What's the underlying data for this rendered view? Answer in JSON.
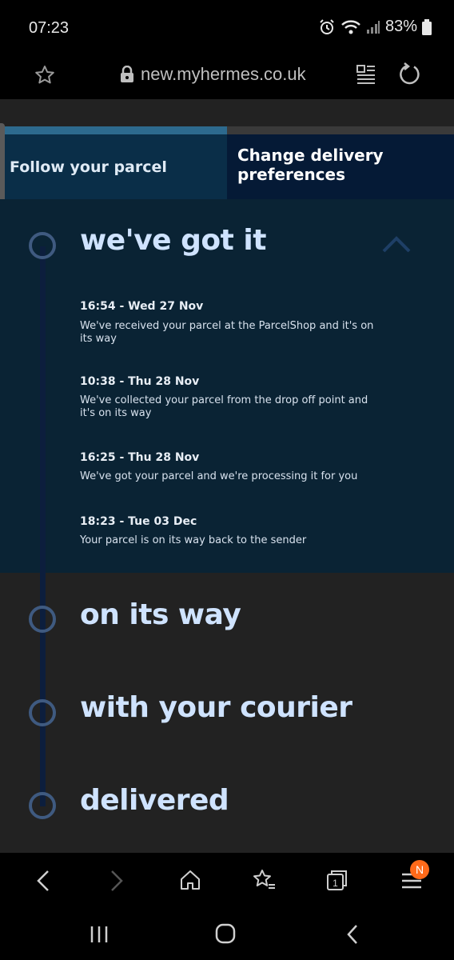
{
  "status_bar": {
    "time": "07:23",
    "battery": "83%",
    "icons": [
      "alarm-icon",
      "wifi-icon",
      "signal-icon",
      "battery-icon"
    ]
  },
  "browser": {
    "url": "new.myhermes.co.uk",
    "icons": [
      "star-icon",
      "lock-icon",
      "reader-mode-icon",
      "reload-icon"
    ]
  },
  "tabs": {
    "follow_label": "Follow your parcel",
    "change_label": "Change delivery preferences"
  },
  "tracking": {
    "stages": [
      {
        "title": "we've got it"
      },
      {
        "title": "on its way"
      },
      {
        "title": "with your courier"
      },
      {
        "title": "delivered"
      }
    ],
    "events": [
      {
        "time": "16:54 - Wed 27 Nov",
        "description": "We've received your parcel at the ParcelShop and it's on its way"
      },
      {
        "time": "10:38 - Thu 28 Nov",
        "description": "We've collected your parcel from the drop off point and it's on its way"
      },
      {
        "time": "16:25 - Thu 28 Nov",
        "description": "We've got your parcel and we're processing it for you"
      },
      {
        "time": "18:23 - Tue 03 Dec",
        "description": "Your parcel is on its way back to the sender"
      }
    ]
  },
  "toolbar": {
    "icons": [
      "back-icon",
      "forward-icon",
      "home-icon",
      "bookmarks-icon",
      "tabs-icon",
      "menu-icon"
    ],
    "tabs_count": "1",
    "menu_badge": "N"
  },
  "navbar": {
    "icons": [
      "recents-icon",
      "home-button-icon",
      "back-nav-icon"
    ]
  },
  "colors": {
    "accent_light": "#cfe3ff",
    "expanded_bg": "#0a2334",
    "tab_active_bg": "#0a2e48",
    "tab_inactive_bg": "#051a36",
    "badge": "#ff6a1a"
  }
}
